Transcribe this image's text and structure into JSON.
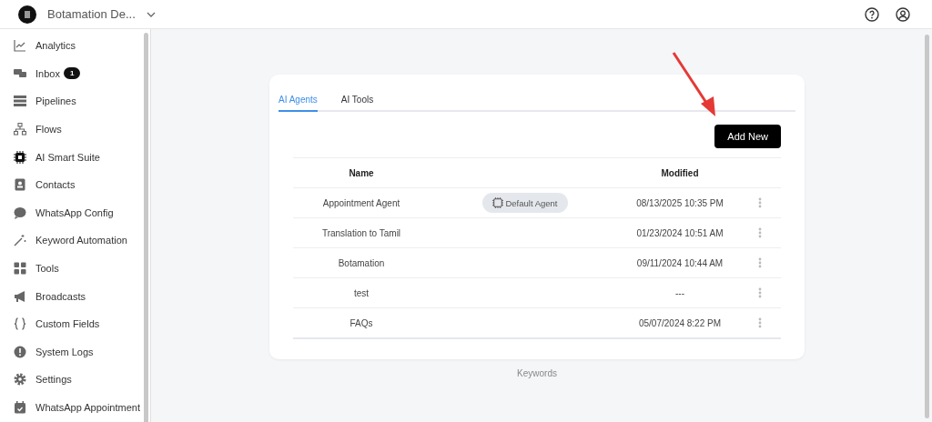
{
  "workspace": {
    "name": "Botamation De..."
  },
  "sidebar": {
    "items": [
      {
        "label": "Analytics"
      },
      {
        "label": "Inbox",
        "badge": "1"
      },
      {
        "label": "Pipelines"
      },
      {
        "label": "Flows"
      },
      {
        "label": "AI Smart Suite"
      },
      {
        "label": "Contacts"
      },
      {
        "label": "WhatsApp Config"
      },
      {
        "label": "Keyword Automation"
      },
      {
        "label": "Tools"
      },
      {
        "label": "Broadcasts"
      },
      {
        "label": "Custom Fields"
      },
      {
        "label": "System Logs"
      },
      {
        "label": "Settings"
      },
      {
        "label": "WhatsApp Appointment"
      }
    ]
  },
  "tabs": [
    {
      "label": "AI Agents",
      "selected": true
    },
    {
      "label": "AI Tools",
      "selected": false
    }
  ],
  "add_button": "Add New",
  "table": {
    "columns": [
      "Name",
      "Modified"
    ],
    "rows": [
      {
        "name": "Appointment Agent",
        "tag": "Default Agent",
        "modified": "08/13/2025 10:35 PM"
      },
      {
        "name": "Translation to Tamil",
        "modified": "01/23/2024 10:51 AM"
      },
      {
        "name": "Botamation",
        "modified": "09/11/2024 10:44 AM"
      },
      {
        "name": "test",
        "modified": "---"
      },
      {
        "name": "FAQs",
        "modified": "05/07/2024 8:22 PM"
      }
    ]
  },
  "footer_label": "Keywords"
}
